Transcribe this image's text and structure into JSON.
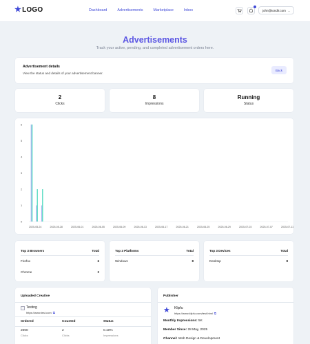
{
  "nav": {
    "logo_text": "LOGO",
    "links": [
      "Dashboard",
      "Advertisements",
      "Marketplace",
      "Inbox"
    ],
    "user_email": "john@tondlr.com"
  },
  "page": {
    "title": "Advertisements",
    "subtitle": "Track your active, pending, and completed advertisement orders here."
  },
  "details": {
    "title": "Advertisement details",
    "description": "View the status and details of your advertisement banner.",
    "back_label": "Back"
  },
  "stats": [
    {
      "value": "2",
      "label": "Clicks"
    },
    {
      "value": "8",
      "label": "Impressions"
    },
    {
      "value": "Running",
      "label": "Status"
    }
  ],
  "chart_data": {
    "type": "bar",
    "ylim": [
      0,
      6
    ],
    "yticks": [
      0,
      1,
      2,
      3,
      4,
      5,
      6
    ],
    "xticks": [
      "2025-05-24",
      "2025-05-28",
      "2025-06-01",
      "2025-06-05",
      "2025-06-09",
      "2025-06-13",
      "2025-06-17",
      "2025-06-21",
      "2025-06-25",
      "2025-06-29",
      "2025-07-03",
      "2025-07-07",
      "2025-07-11"
    ],
    "series": [
      {
        "color": "#a8b4f0",
        "bars": [
          {
            "x": "2025-05-24",
            "value": 6
          },
          {
            "x": "2025-05-25",
            "value": 1
          },
          {
            "x": "2025-05-26",
            "value": 1
          }
        ]
      },
      {
        "color": "#3ed6b8",
        "bars": [
          {
            "x": "2025-05-24",
            "value": 6
          },
          {
            "x": "2025-05-25",
            "value": 2
          },
          {
            "x": "2025-05-26",
            "value": 2
          }
        ]
      }
    ]
  },
  "top": [
    {
      "title": "Top 3 Browsers",
      "total_label": "Total",
      "rows": [
        {
          "name": "Firefox",
          "count": "6"
        },
        {
          "name": "Chrome",
          "count": "2"
        }
      ]
    },
    {
      "title": "Top 3 Platforms",
      "total_label": "Total",
      "rows": [
        {
          "name": "Windows",
          "count": "8"
        }
      ]
    },
    {
      "title": "Top 3 Devices",
      "total_label": "Total",
      "rows": [
        {
          "name": "Desktop",
          "count": "8"
        }
      ]
    }
  ],
  "creative": {
    "title": "Uploaded Creative",
    "name": "Testing",
    "url": "https://www.test.com",
    "headers": [
      "Ordered",
      "Counted",
      "Status"
    ],
    "values": [
      "2000",
      "2",
      "0.10%"
    ],
    "subs": [
      "Clicks",
      "Clicks",
      "Impressions"
    ]
  },
  "publisher": {
    "title": "Publisher",
    "name": "Klipfu",
    "url": "https://www.klipfu.com/test.html",
    "impressions_label": "Monthly Impressions:",
    "impressions_value": "5K",
    "member_label": "Member Since:",
    "member_value": "28 May, 2025",
    "channel_label": "Channel:",
    "channel_value": "Web Design & Development"
  }
}
